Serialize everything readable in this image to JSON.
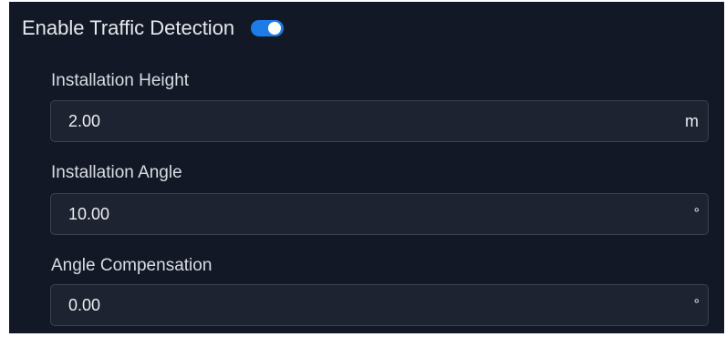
{
  "traffic_detection": {
    "label": "Enable Traffic Detection",
    "enabled": true,
    "accent_color": "#1e7ce8"
  },
  "fields": [
    {
      "label": "Installation Height",
      "value": "2.00",
      "unit": "m"
    },
    {
      "label": "Installation Angle",
      "value": "10.00",
      "unit": "°"
    },
    {
      "label": "Angle Compensation",
      "value": "0.00",
      "unit": "°"
    }
  ]
}
